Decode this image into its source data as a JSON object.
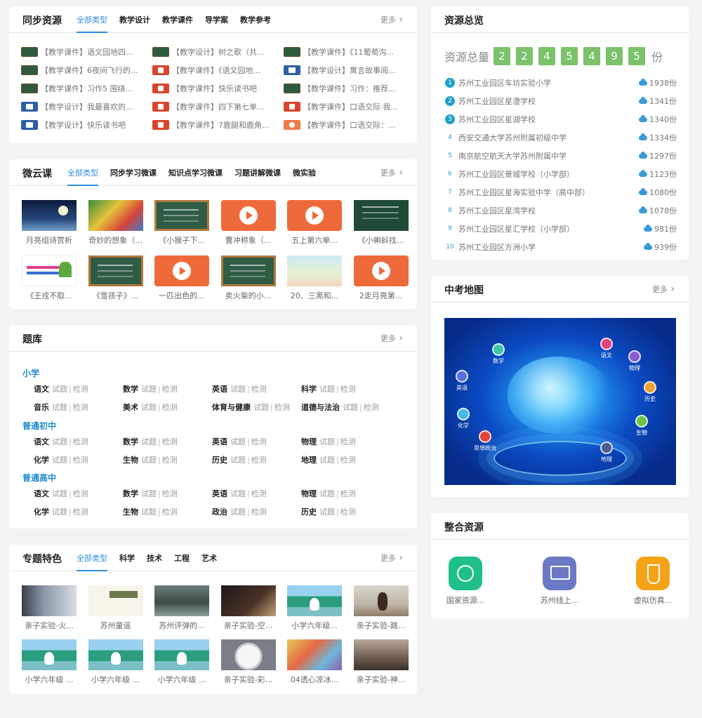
{
  "sync": {
    "title": "同步资源",
    "tabs": [
      "全部类型",
      "教学设计",
      "教学课件",
      "导学案",
      "教学参考"
    ],
    "more": "更多",
    "items": [
      {
        "icon": "board",
        "text": "【教学课件】语文园地四..."
      },
      {
        "icon": "board",
        "text": "【教学设计】树之歌（共..."
      },
      {
        "icon": "board",
        "text": "【教学课件】《11葡萄沟..."
      },
      {
        "icon": "board",
        "text": "【教学课件】6夜间飞行的..."
      },
      {
        "icon": "ppt",
        "text": "【教学课件】《语文园地..."
      },
      {
        "icon": "doc",
        "text": "【教学设计】寓言故事阅..."
      },
      {
        "icon": "board",
        "text": "【教学课件】习作5 围绕..."
      },
      {
        "icon": "ppt",
        "text": "【教学课件】快乐读书吧"
      },
      {
        "icon": "board",
        "text": "【教学课件】习作：推荐..."
      },
      {
        "icon": "doc",
        "text": "【教学设计】我最喜欢的..."
      },
      {
        "icon": "ppt",
        "text": "【教学课件】四下第七单..."
      },
      {
        "icon": "ppt",
        "text": "【教学课件】口语交际·我..."
      },
      {
        "icon": "doc",
        "text": "【教学设计】快乐读书吧"
      },
      {
        "icon": "ppt",
        "text": "【教学课件】7鹿腿和鹿角..."
      },
      {
        "icon": "vid",
        "text": "【教学课件】口语交际：..."
      }
    ]
  },
  "micro": {
    "title": "微云课",
    "tabs": [
      "全部类型",
      "同步学习微课",
      "知识点学习微课",
      "习题讲解微课",
      "微实验"
    ],
    "more": "更多",
    "items": [
      {
        "thumb": "t-night",
        "caption": "月亮组诗赏析"
      },
      {
        "thumb": "t-colorful",
        "caption": "奇妙的想象（..."
      },
      {
        "thumb": "t-board",
        "caption": "《小猴子下..."
      },
      {
        "thumb": "t-play",
        "caption": "曹冲称象（..."
      },
      {
        "thumb": "t-play",
        "caption": "五上第六单..."
      },
      {
        "thumb": "t-board2",
        "caption": "《小蝌蚪找..."
      },
      {
        "thumb": "t-paper",
        "caption": "《王戎不取..."
      },
      {
        "thumb": "t-board",
        "caption": "《雪孩子》..."
      },
      {
        "thumb": "t-play",
        "caption": "一匹出色的..."
      },
      {
        "thumb": "t-board",
        "caption": "卖火柴的小..."
      },
      {
        "thumb": "t-pastel",
        "caption": "20、三黑和..."
      },
      {
        "thumb": "t-play",
        "caption": "2走月亮第..."
      }
    ]
  },
  "bank": {
    "title": "题库",
    "more": "更多",
    "link_test": "试题",
    "link_check": "检测",
    "levels": [
      {
        "name": "小学",
        "rows": [
          [
            "语文",
            "数学",
            "英语",
            "科学"
          ],
          [
            "音乐",
            "美术",
            "体育与健康",
            "道德与法治"
          ]
        ]
      },
      {
        "name": "普通初中",
        "rows": [
          [
            "语文",
            "数学",
            "英语",
            "物理"
          ],
          [
            "化学",
            "生物",
            "历史",
            "地理"
          ]
        ]
      },
      {
        "name": "普通高中",
        "rows": [
          [
            "语文",
            "数学",
            "英语",
            "物理"
          ],
          [
            "化学",
            "生物",
            "政治",
            "历史"
          ]
        ]
      }
    ]
  },
  "special": {
    "title": "专题特色",
    "tabs": [
      "全部类型",
      "科学",
      "技术",
      "工程",
      "艺术"
    ],
    "more": "更多",
    "items": [
      {
        "thumb": "t-lab",
        "caption": "亲子实验-火..."
      },
      {
        "thumb": "t-cal",
        "caption": "苏州童谣"
      },
      {
        "thumb": "t-bridge",
        "caption": "苏州评弹的..."
      },
      {
        "thumb": "t-dark",
        "caption": "亲子实验-空..."
      },
      {
        "thumb": "t-school",
        "caption": "小学六年级..."
      },
      {
        "thumb": "t-room",
        "caption": "亲子实验-跳..."
      },
      {
        "thumb": "t-school",
        "caption": "小学六年级 ..."
      },
      {
        "thumb": "t-school",
        "caption": "小学六年级 ..."
      },
      {
        "thumb": "t-school",
        "caption": "小学六年级 ..."
      },
      {
        "thumb": "t-plate",
        "caption": "亲子实验-彩..."
      },
      {
        "thumb": "t-art",
        "caption": "04透心凉冰..."
      },
      {
        "thumb": "t-kid",
        "caption": "亲子实验-神..."
      }
    ]
  },
  "overview": {
    "title": "资源总览",
    "total_label": "资源总量",
    "digits": [
      "2",
      "2",
      "4",
      "5",
      "4",
      "9",
      "5"
    ],
    "unit": "份",
    "ranking": [
      {
        "no": "1",
        "name": "苏州工业园区车坊实验小学",
        "count": "1938份"
      },
      {
        "no": "2",
        "name": "苏州工业园区星澄学校",
        "count": "1341份"
      },
      {
        "no": "3",
        "name": "苏州工业园区星湖学校",
        "count": "1340份"
      },
      {
        "no": "4",
        "name": "西安交通大学苏州附属初级中学",
        "count": "1334份"
      },
      {
        "no": "5",
        "name": "南京航空航天大学苏州附属中学",
        "count": "1297份"
      },
      {
        "no": "6",
        "name": "苏州工业园区景城学校（小学部）",
        "count": "1123份"
      },
      {
        "no": "7",
        "name": "苏州工业园区星海实验中学（高中部）",
        "count": "1080份"
      },
      {
        "no": "8",
        "name": "苏州工业园区星湾学校",
        "count": "1078份"
      },
      {
        "no": "9",
        "name": "苏州工业园区星汇学校（小学部）",
        "count": "981份"
      },
      {
        "no": "10",
        "name": "苏州工业园区方洲小学",
        "count": "939份"
      }
    ]
  },
  "exam_map": {
    "title": "中考地图",
    "more": "更多",
    "subjects": [
      {
        "label": "数学",
        "color": "#3cc4a8"
      },
      {
        "label": "语文",
        "color": "#e0457a"
      },
      {
        "label": "物理",
        "color": "#8a5ad0"
      },
      {
        "label": "英语",
        "color": "#5a6de0"
      },
      {
        "label": "历史",
        "color": "#f0a030"
      },
      {
        "label": "化学",
        "color": "#46b6e6"
      },
      {
        "label": "生物",
        "color": "#6cc24a"
      },
      {
        "label": "思想政治",
        "color": "#e2453a"
      },
      {
        "label": "地理",
        "color": "#4a6090"
      }
    ]
  },
  "integrated": {
    "title": "整合资源",
    "items": [
      {
        "icon": "globe-icon",
        "caption": "国家资源..."
      },
      {
        "icon": "screen-icon",
        "caption": "苏州线上..."
      },
      {
        "icon": "flask-icon",
        "caption": "虚拟仿真..."
      }
    ]
  }
}
